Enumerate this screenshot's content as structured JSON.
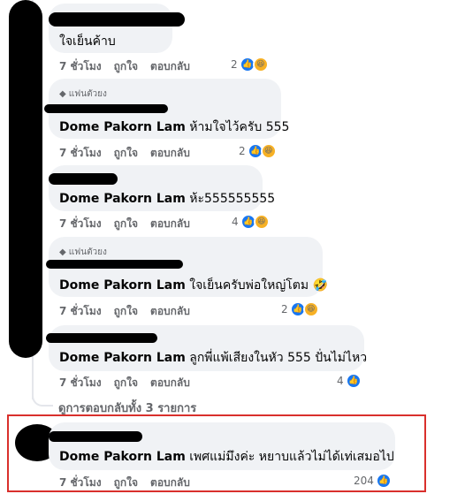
{
  "comments": [
    {
      "text": "ใจเย็นค้าบ",
      "author": "",
      "badge": "",
      "time": "7 ชั่วโมง",
      "reactions": {
        "count": "2",
        "types": [
          "like",
          "haha"
        ]
      }
    },
    {
      "author": "Dome Pakorn Lam",
      "text": "ห้ามใจไว้ครับ 555",
      "badge": "แฟนตัวยง",
      "time": "7 ชั่วโมง",
      "reactions": {
        "count": "2",
        "types": [
          "like",
          "haha"
        ]
      }
    },
    {
      "author": "Dome Pakorn Lam",
      "text": "ห้ะ555555555",
      "badge": "",
      "time": "7 ชั่วโมง",
      "reactions": {
        "count": "4",
        "types": [
          "like",
          "haha"
        ]
      }
    },
    {
      "author": "Dome Pakorn Lam",
      "text": "ใจเย็นครับพ่อใหญ่โตม 🤣",
      "badge": "แฟนตัวยง",
      "time": "7 ชั่วโมง",
      "reactions": {
        "count": "2",
        "types": [
          "like",
          "haha"
        ]
      }
    },
    {
      "author": "Dome Pakorn Lam",
      "text": "ลูกพี่แพ้เสียงในหัว 555 ปั่นไม่ไหว",
      "badge": "",
      "time": "7 ชั่วโมง",
      "reactions": {
        "count": "4",
        "types": [
          "like"
        ]
      }
    },
    {
      "author": "Dome Pakorn Lam",
      "text": "เพศแม่มึงค่ะ หยาบแล้วไม่ได้เท่เสมอไป",
      "badge": "",
      "time": "7 ชั่วโมง",
      "reactions": {
        "count": "204",
        "types": [
          "like"
        ]
      }
    }
  ],
  "actions": {
    "like": "ถูกใจ",
    "reply": "ตอบกลับ"
  },
  "view_replies": "ดูการตอบกลับทั้ง 3 รายการ",
  "colors": {
    "highlight": "#d9302c",
    "like": "#1877f2",
    "haha": "#f7b125",
    "bubble": "#f0f2f5"
  },
  "icons": {
    "badge": "diamond-icon",
    "like": "like-reaction-icon",
    "haha": "haha-reaction-icon"
  }
}
